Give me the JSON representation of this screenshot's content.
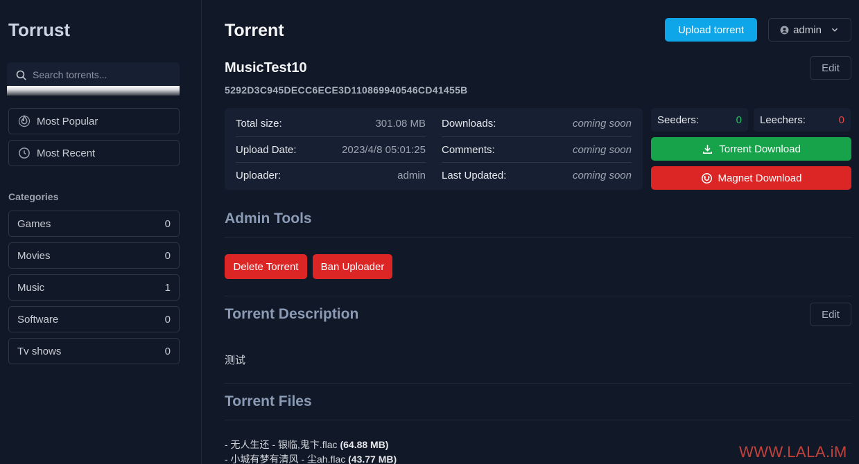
{
  "sidebar": {
    "brand": "Torrust",
    "search_placeholder": "Search torrents...",
    "nav": [
      {
        "label": "Most Popular",
        "icon": "flame-icon"
      },
      {
        "label": "Most Recent",
        "icon": "clock-icon"
      }
    ],
    "categories_title": "Categories",
    "categories": [
      {
        "name": "Games",
        "count": "0"
      },
      {
        "name": "Movies",
        "count": "0"
      },
      {
        "name": "Music",
        "count": "1"
      },
      {
        "name": "Software",
        "count": "0"
      },
      {
        "name": "Tv shows",
        "count": "0"
      }
    ]
  },
  "header": {
    "title": "Torrent",
    "upload_label": "Upload torrent",
    "user_label": "admin"
  },
  "torrent": {
    "name": "MusicTest10",
    "hash": "5292D3C945DECC6ECE3D110869940546CD41455B",
    "edit_label": "Edit",
    "stats_left": [
      {
        "label": "Total size:",
        "value": "301.08 MB"
      },
      {
        "label": "Upload Date:",
        "value": "2023/4/8 05:01:25"
      },
      {
        "label": "Uploader:",
        "value": "admin"
      }
    ],
    "stats_right": [
      {
        "label": "Downloads:",
        "value": "coming soon"
      },
      {
        "label": "Comments:",
        "value": "coming soon"
      },
      {
        "label": "Last Updated:",
        "value": "coming soon"
      }
    ],
    "seeders_label": "Seeders:",
    "seeders_value": "0",
    "leechers_label": "Leechers:",
    "leechers_value": "0",
    "torrent_download_label": "Torrent Download",
    "magnet_download_label": "Magnet Download"
  },
  "admin_tools": {
    "title": "Admin Tools",
    "delete_label": "Delete Torrent",
    "ban_label": "Ban Uploader"
  },
  "description": {
    "title": "Torrent Description",
    "edit_label": "Edit",
    "text": "测试"
  },
  "files": {
    "title": "Torrent Files",
    "items": [
      {
        "name": "- 无人生还 - 银临,鬼卞.flac",
        "size": "(64.88 MB)"
      },
      {
        "name": "- 小城有梦有清风 - 尘ah.flac",
        "size": "(43.77 MB)"
      }
    ]
  },
  "watermark": "WWW.LALA.iM",
  "colors": {
    "accent_blue": "#0ea5e9",
    "download_green": "#16a34a",
    "danger_red": "#dc2626",
    "seeders_green": "#22c55e",
    "leechers_red": "#ef4444"
  }
}
